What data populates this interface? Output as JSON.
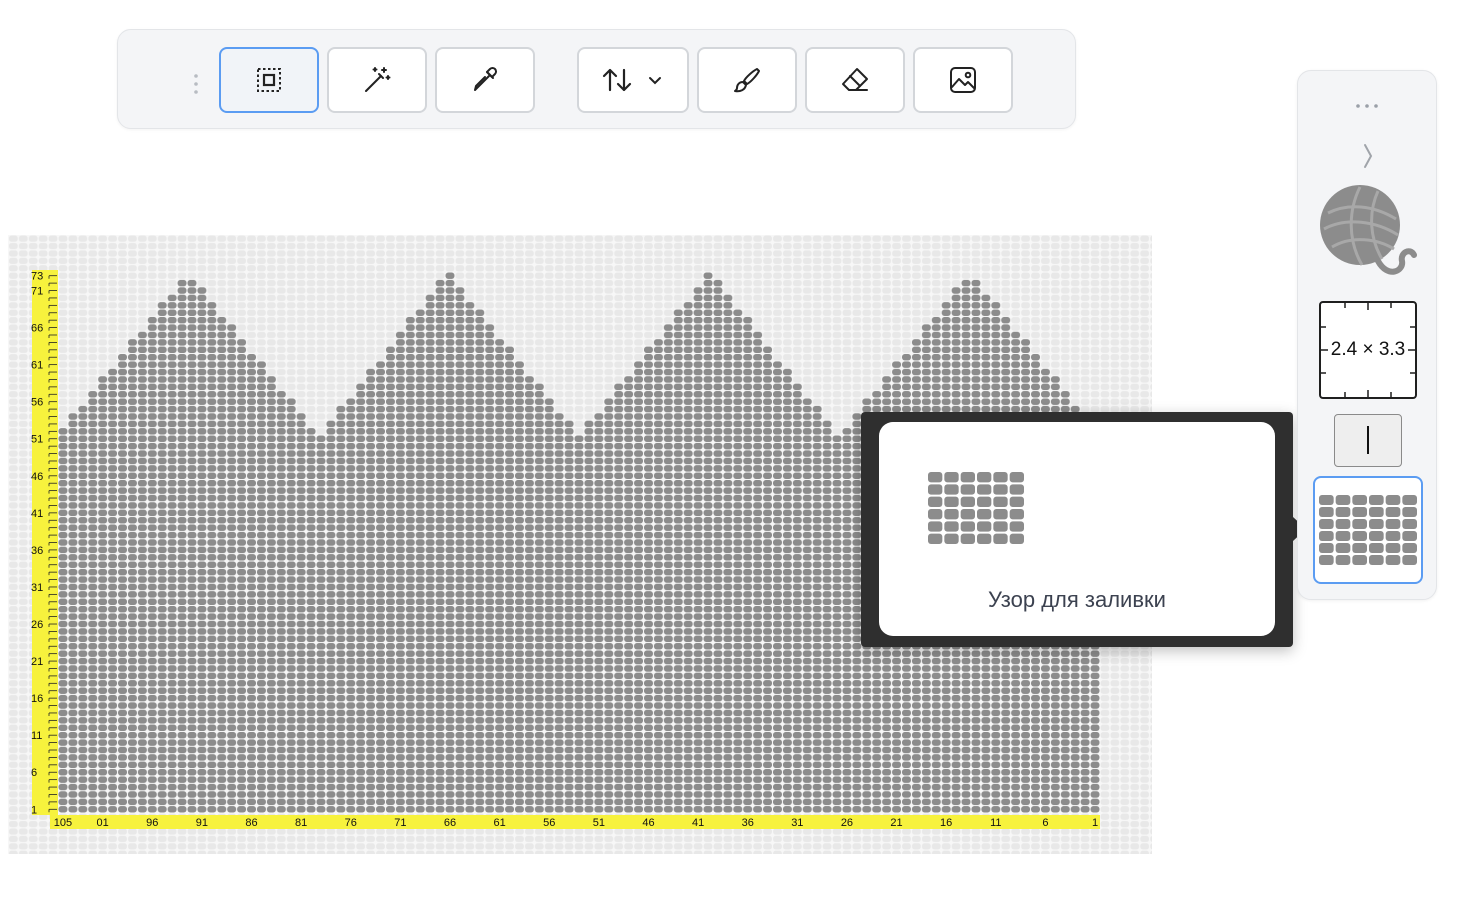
{
  "toolbar": {
    "tools": [
      {
        "name": "select-tool",
        "icon": "select-icon",
        "active": true
      },
      {
        "name": "magic-wand-tool",
        "icon": "magic-wand-icon",
        "active": false
      },
      {
        "name": "eyedropper-tool",
        "icon": "eyedropper-icon",
        "active": false
      },
      {
        "name": "direction-dropdown",
        "icon": "swap-vertical-icon",
        "active": false
      },
      {
        "name": "brush-tool",
        "icon": "brush-icon",
        "active": false
      },
      {
        "name": "eraser-tool",
        "icon": "eraser-icon",
        "active": false
      },
      {
        "name": "image-tool",
        "icon": "image-icon",
        "active": false
      }
    ]
  },
  "chart": {
    "columns": 105,
    "rows": 73,
    "column_labels": [
      "105",
      "01",
      "96",
      "91",
      "86",
      "81",
      "76",
      "71",
      "66",
      "61",
      "56",
      "51",
      "46",
      "41",
      "36",
      "31",
      "26",
      "21",
      "16",
      "11",
      "6",
      "1"
    ],
    "row_labels": [
      "73",
      "71",
      "66",
      "61",
      "56",
      "51",
      "46",
      "41",
      "36",
      "31",
      "26",
      "21",
      "16",
      "11",
      "6",
      "1"
    ],
    "filled_color": "#8c8c8c",
    "empty_color": "#e8e8e8",
    "ruler_color": "#f7f23d",
    "peak_count": 4,
    "peak_height": 73,
    "valley_height": 51
  },
  "tooltip": {
    "label": "Узор для заливки",
    "icon": "fill-pattern-icon"
  },
  "side_panel": {
    "more_icon": "more-horizontal-icon",
    "collapse_icon": "chevron-right-icon",
    "yarn_icon": "yarn-ball-icon",
    "yarn_color": "#8c8c8c",
    "gauge_label": "2.4 × 3.3",
    "stitch_icon": "stitch-line-icon",
    "fill_pattern_icon": "fill-pattern-icon"
  },
  "colors": {
    "accent": "#5b9cf2",
    "tooltip_bg": "#2f2f2f"
  }
}
